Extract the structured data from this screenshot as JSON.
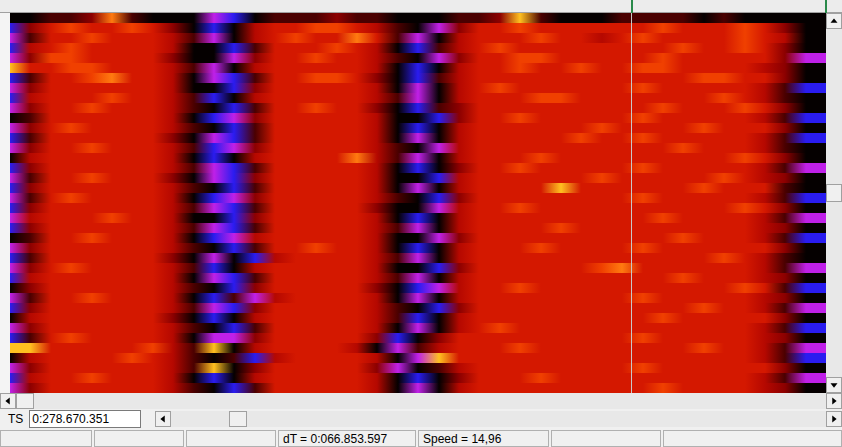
{
  "spectrogram": {
    "rows": [
      [
        2,
        2,
        3,
        3,
        4,
        8,
        3,
        2,
        2,
        2,
        1,
        0,
        2,
        3,
        3,
        3,
        4,
        3,
        3,
        2,
        2,
        2,
        3,
        3,
        4,
        9,
        3,
        2,
        2,
        2,
        3,
        3,
        3,
        3,
        2,
        3,
        2,
        2,
        2,
        2
      ],
      [
        0,
        4,
        6,
        7,
        6,
        6,
        7,
        6,
        4,
        2,
        0,
        2,
        5,
        6,
        6,
        7,
        7,
        6,
        5,
        3,
        2,
        1,
        4,
        6,
        6,
        7,
        6,
        6,
        6,
        6,
        6,
        6,
        7,
        6,
        6,
        6,
        7,
        6,
        4,
        2
      ],
      [
        1,
        3,
        6,
        6,
        7,
        6,
        6,
        6,
        5,
        3,
        1,
        2,
        5,
        6,
        7,
        6,
        6,
        8,
        6,
        3,
        1,
        2,
        5,
        6,
        6,
        6,
        7,
        6,
        6,
        5,
        6,
        7,
        6,
        6,
        6,
        6,
        7,
        6,
        5,
        2
      ],
      [
        0,
        5,
        6,
        7,
        6,
        6,
        6,
        6,
        5,
        2,
        2,
        0,
        3,
        6,
        6,
        6,
        7,
        6,
        5,
        2,
        0,
        3,
        5,
        6,
        7,
        6,
        6,
        6,
        6,
        6,
        6,
        6,
        6,
        7,
        6,
        6,
        7,
        6,
        4,
        2
      ],
      [
        1,
        4,
        7,
        7,
        6,
        6,
        6,
        6,
        4,
        2,
        2,
        1,
        4,
        6,
        6,
        7,
        6,
        6,
        5,
        3,
        2,
        1,
        4,
        6,
        6,
        7,
        7,
        6,
        6,
        6,
        6,
        6,
        7,
        6,
        6,
        6,
        6,
        6,
        4,
        1
      ],
      [
        9,
        6,
        6,
        7,
        7,
        6,
        6,
        6,
        5,
        3,
        1,
        2,
        5,
        6,
        6,
        6,
        6,
        6,
        5,
        2,
        0,
        2,
        5,
        6,
        6,
        7,
        6,
        6,
        7,
        6,
        6,
        7,
        7,
        6,
        6,
        6,
        6,
        5,
        4,
        2
      ],
      [
        0,
        3,
        6,
        6,
        7,
        8,
        6,
        6,
        5,
        2,
        1,
        0,
        3,
        6,
        6,
        7,
        7,
        6,
        4,
        2,
        0,
        3,
        5,
        6,
        6,
        6,
        6,
        6,
        6,
        6,
        6,
        6,
        6,
        6,
        7,
        7,
        6,
        6,
        4,
        2
      ],
      [
        1,
        4,
        6,
        6,
        6,
        6,
        6,
        6,
        5,
        2,
        2,
        0,
        4,
        6,
        6,
        6,
        6,
        6,
        5,
        2,
        1,
        2,
        5,
        6,
        7,
        6,
        6,
        6,
        6,
        6,
        6,
        7,
        6,
        6,
        6,
        6,
        6,
        5,
        3,
        0
      ],
      [
        0,
        5,
        6,
        6,
        6,
        7,
        6,
        6,
        5,
        3,
        0,
        2,
        5,
        6,
        6,
        6,
        6,
        6,
        5,
        3,
        1,
        2,
        5,
        6,
        6,
        6,
        7,
        7,
        6,
        6,
        6,
        6,
        6,
        6,
        6,
        7,
        6,
        5,
        3,
        2
      ],
      [
        1,
        4,
        6,
        6,
        7,
        6,
        6,
        6,
        5,
        3,
        2,
        0,
        3,
        6,
        6,
        7,
        6,
        6,
        4,
        2,
        0,
        3,
        4,
        6,
        6,
        6,
        6,
        6,
        6,
        6,
        6,
        6,
        7,
        6,
        6,
        6,
        7,
        6,
        4,
        2
      ],
      [
        2,
        3,
        6,
        6,
        6,
        6,
        6,
        6,
        5,
        2,
        0,
        1,
        4,
        6,
        6,
        6,
        6,
        6,
        5,
        2,
        2,
        0,
        4,
        6,
        6,
        7,
        6,
        6,
        6,
        6,
        6,
        7,
        6,
        6,
        6,
        6,
        6,
        5,
        3,
        0
      ],
      [
        1,
        4,
        6,
        7,
        6,
        6,
        6,
        6,
        5,
        3,
        2,
        0,
        3,
        6,
        6,
        6,
        6,
        6,
        5,
        2,
        0,
        2,
        5,
        6,
        6,
        6,
        6,
        6,
        6,
        7,
        6,
        6,
        6,
        6,
        7,
        6,
        6,
        6,
        4,
        2
      ],
      [
        0,
        3,
        6,
        6,
        6,
        6,
        6,
        6,
        4,
        2,
        1,
        0,
        3,
        6,
        6,
        6,
        6,
        6,
        5,
        2,
        1,
        2,
        5,
        6,
        6,
        6,
        6,
        6,
        7,
        6,
        6,
        7,
        6,
        6,
        6,
        6,
        6,
        5,
        3,
        0
      ],
      [
        1,
        4,
        6,
        6,
        7,
        6,
        6,
        6,
        5,
        3,
        0,
        1,
        4,
        6,
        6,
        6,
        6,
        6,
        5,
        3,
        2,
        1,
        5,
        6,
        6,
        6,
        6,
        6,
        6,
        6,
        6,
        6,
        6,
        7,
        6,
        6,
        6,
        5,
        3,
        2
      ],
      [
        2,
        5,
        6,
        6,
        6,
        6,
        6,
        6,
        5,
        2,
        0,
        2,
        5,
        6,
        6,
        6,
        6,
        8,
        5,
        3,
        1,
        2,
        5,
        6,
        6,
        6,
        7,
        6,
        6,
        6,
        6,
        6,
        6,
        6,
        6,
        6,
        7,
        6,
        4,
        2
      ],
      [
        0,
        4,
        6,
        6,
        6,
        6,
        6,
        6,
        5,
        3,
        1,
        0,
        3,
        6,
        6,
        6,
        6,
        6,
        5,
        2,
        0,
        2,
        4,
        6,
        6,
        7,
        6,
        6,
        6,
        6,
        6,
        7,
        6,
        6,
        6,
        6,
        6,
        5,
        3,
        1
      ],
      [
        1,
        3,
        6,
        6,
        7,
        6,
        6,
        6,
        4,
        2,
        1,
        0,
        4,
        6,
        6,
        6,
        6,
        6,
        5,
        2,
        2,
        0,
        5,
        6,
        6,
        6,
        6,
        6,
        6,
        7,
        6,
        6,
        6,
        6,
        6,
        7,
        6,
        5,
        4,
        2
      ],
      [
        0,
        4,
        6,
        6,
        6,
        6,
        6,
        6,
        5,
        3,
        2,
        0,
        3,
        6,
        6,
        6,
        6,
        6,
        5,
        2,
        1,
        2,
        5,
        6,
        6,
        6,
        6,
        9,
        6,
        6,
        6,
        6,
        6,
        6,
        7,
        6,
        6,
        6,
        3,
        2
      ],
      [
        1,
        3,
        6,
        7,
        6,
        6,
        6,
        6,
        5,
        2,
        0,
        1,
        4,
        6,
        6,
        6,
        6,
        6,
        5,
        3,
        2,
        0,
        4,
        6,
        6,
        6,
        6,
        6,
        6,
        6,
        6,
        7,
        6,
        6,
        6,
        6,
        6,
        5,
        3,
        0
      ],
      [
        0,
        4,
        6,
        6,
        6,
        6,
        6,
        6,
        5,
        3,
        1,
        0,
        3,
        6,
        6,
        6,
        6,
        6,
        4,
        2,
        2,
        1,
        5,
        6,
        6,
        7,
        6,
        6,
        6,
        6,
        6,
        6,
        6,
        6,
        6,
        6,
        7,
        6,
        4,
        2
      ],
      [
        1,
        5,
        6,
        6,
        6,
        7,
        6,
        6,
        5,
        2,
        2,
        0,
        4,
        6,
        6,
        6,
        6,
        6,
        5,
        2,
        0,
        2,
        5,
        6,
        6,
        6,
        6,
        6,
        6,
        6,
        6,
        6,
        7,
        6,
        6,
        6,
        6,
        5,
        3,
        1
      ],
      [
        0,
        4,
        6,
        6,
        6,
        6,
        6,
        6,
        5,
        3,
        1,
        0,
        3,
        6,
        6,
        6,
        6,
        6,
        5,
        3,
        1,
        2,
        5,
        6,
        6,
        6,
        6,
        7,
        6,
        6,
        6,
        6,
        6,
        6,
        6,
        6,
        6,
        5,
        4,
        2
      ],
      [
        2,
        3,
        6,
        6,
        7,
        6,
        6,
        6,
        5,
        2,
        0,
        1,
        5,
        6,
        6,
        6,
        6,
        6,
        5,
        2,
        2,
        1,
        4,
        6,
        6,
        6,
        6,
        6,
        6,
        6,
        6,
        6,
        6,
        7,
        6,
        6,
        6,
        5,
        3,
        0
      ],
      [
        1,
        4,
        6,
        6,
        6,
        6,
        6,
        6,
        5,
        3,
        2,
        0,
        3,
        6,
        6,
        7,
        6,
        6,
        5,
        2,
        0,
        2,
        5,
        6,
        6,
        6,
        7,
        6,
        6,
        6,
        6,
        7,
        6,
        6,
        6,
        6,
        6,
        6,
        4,
        2
      ],
      [
        0,
        3,
        6,
        6,
        6,
        6,
        6,
        6,
        4,
        2,
        1,
        2,
        0,
        5,
        6,
        6,
        6,
        6,
        5,
        3,
        1,
        2,
        5,
        6,
        6,
        6,
        6,
        6,
        6,
        6,
        6,
        6,
        6,
        6,
        6,
        7,
        6,
        5,
        3,
        2
      ],
      [
        1,
        4,
        6,
        7,
        6,
        6,
        6,
        6,
        5,
        3,
        0,
        2,
        5,
        6,
        6,
        6,
        6,
        6,
        5,
        2,
        2,
        0,
        4,
        6,
        6,
        6,
        6,
        6,
        6,
        7,
        8,
        6,
        6,
        6,
        6,
        6,
        6,
        5,
        3,
        1
      ],
      [
        0,
        5,
        6,
        6,
        6,
        6,
        6,
        6,
        5,
        2,
        1,
        0,
        3,
        6,
        6,
        6,
        6,
        6,
        5,
        3,
        1,
        2,
        5,
        6,
        6,
        6,
        6,
        6,
        6,
        6,
        6,
        6,
        6,
        7,
        6,
        6,
        6,
        5,
        4,
        2
      ],
      [
        2,
        4,
        6,
        6,
        6,
        6,
        6,
        6,
        5,
        3,
        2,
        0,
        4,
        6,
        6,
        6,
        6,
        6,
        4,
        2,
        0,
        1,
        5,
        6,
        6,
        7,
        6,
        6,
        6,
        6,
        6,
        6,
        6,
        6,
        6,
        6,
        7,
        6,
        3,
        0
      ],
      [
        1,
        3,
        6,
        6,
        7,
        6,
        6,
        6,
        5,
        2,
        0,
        3,
        1,
        5,
        6,
        6,
        6,
        6,
        5,
        2,
        1,
        2,
        5,
        6,
        6,
        6,
        6,
        6,
        6,
        6,
        6,
        7,
        6,
        6,
        6,
        6,
        6,
        5,
        4,
        2
      ],
      [
        0,
        4,
        6,
        6,
        6,
        6,
        6,
        6,
        5,
        3,
        1,
        0,
        4,
        6,
        6,
        6,
        6,
        6,
        5,
        3,
        2,
        0,
        4,
        6,
        6,
        6,
        6,
        6,
        6,
        6,
        6,
        6,
        6,
        6,
        7,
        6,
        6,
        5,
        3,
        1
      ],
      [
        2,
        5,
        6,
        6,
        6,
        6,
        6,
        6,
        4,
        2,
        0,
        2,
        5,
        6,
        6,
        6,
        6,
        6,
        5,
        3,
        0,
        2,
        5,
        6,
        6,
        6,
        6,
        6,
        6,
        6,
        6,
        6,
        7,
        6,
        6,
        6,
        6,
        6,
        4,
        2
      ],
      [
        1,
        4,
        6,
        6,
        6,
        6,
        6,
        6,
        5,
        3,
        2,
        0,
        3,
        6,
        6,
        6,
        6,
        6,
        5,
        2,
        1,
        2,
        5,
        6,
        7,
        6,
        6,
        6,
        6,
        6,
        6,
        6,
        6,
        6,
        6,
        6,
        6,
        5,
        3,
        0
      ],
      [
        0,
        3,
        6,
        7,
        6,
        6,
        6,
        6,
        5,
        2,
        1,
        1,
        4,
        6,
        6,
        6,
        6,
        6,
        4,
        0,
        2,
        4,
        6,
        6,
        6,
        6,
        6,
        6,
        6,
        6,
        6,
        7,
        6,
        6,
        6,
        6,
        6,
        5,
        4,
        2
      ],
      [
        9,
        9,
        6,
        6,
        6,
        6,
        6,
        7,
        5,
        3,
        9,
        2,
        5,
        6,
        6,
        6,
        6,
        5,
        2,
        1,
        3,
        5,
        6,
        6,
        6,
        7,
        6,
        6,
        6,
        6,
        6,
        6,
        6,
        6,
        7,
        6,
        6,
        5,
        3,
        1
      ],
      [
        2,
        5,
        6,
        6,
        6,
        6,
        7,
        6,
        5,
        3,
        2,
        3,
        0,
        5,
        6,
        6,
        6,
        6,
        5,
        2,
        1,
        9,
        6,
        6,
        6,
        6,
        6,
        6,
        6,
        6,
        6,
        6,
        6,
        6,
        6,
        6,
        6,
        5,
        3,
        0
      ],
      [
        1,
        4,
        6,
        6,
        6,
        6,
        6,
        6,
        5,
        3,
        9,
        2,
        4,
        6,
        6,
        6,
        6,
        6,
        4,
        1,
        2,
        3,
        5,
        6,
        6,
        6,
        6,
        6,
        6,
        6,
        6,
        7,
        6,
        6,
        6,
        6,
        6,
        6,
        4,
        2
      ],
      [
        0,
        5,
        6,
        6,
        7,
        6,
        6,
        6,
        5,
        2,
        0,
        2,
        5,
        6,
        6,
        6,
        6,
        6,
        5,
        2,
        0,
        2,
        4,
        6,
        6,
        6,
        7,
        6,
        6,
        6,
        6,
        6,
        6,
        6,
        6,
        6,
        6,
        5,
        3,
        1
      ],
      [
        1,
        4,
        6,
        6,
        6,
        6,
        6,
        6,
        5,
        3,
        2,
        0,
        3,
        6,
        6,
        6,
        6,
        6,
        5,
        2,
        1,
        2,
        5,
        6,
        6,
        6,
        6,
        6,
        6,
        6,
        6,
        6,
        7,
        6,
        6,
        6,
        6,
        5,
        4,
        2
      ]
    ],
    "cursor": {
      "level": 0.761
    }
  },
  "scrollbars": {
    "vertical": {
      "level": 0.47
    },
    "horizontal": {
      "level": 0
    },
    "timeline": {
      "level": 0.09
    }
  },
  "timestamp": {
    "label": "TS",
    "value": "0:278.670.351"
  },
  "status_bar": [
    {
      "text": ""
    },
    {
      "text": ""
    },
    {
      "text": ""
    },
    {
      "text": "dT = 0:066.853.597"
    },
    {
      "text": "Speed = 14,96"
    },
    {
      "text": ""
    },
    {
      "text": ""
    }
  ]
}
